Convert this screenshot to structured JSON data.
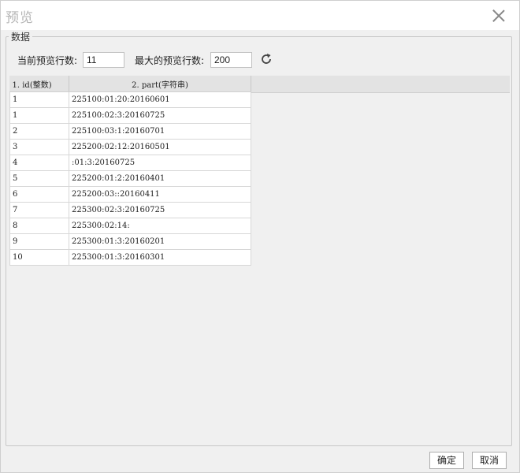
{
  "dialog": {
    "title": "预览",
    "group_title": "数据"
  },
  "controls": {
    "current_rows_label": "当前预览行数:",
    "current_rows_value": "11",
    "max_rows_label": "最大的预览行数:",
    "max_rows_value": "200",
    "refresh_icon": "refresh-icon"
  },
  "table": {
    "headers": [
      "1. id(整数)",
      "2. part(字符串)"
    ],
    "rows": [
      [
        "1",
        "225100:01:20:20160601"
      ],
      [
        "1",
        "225100:02:3:20160725"
      ],
      [
        "2",
        "225100:03:1:20160701"
      ],
      [
        "3",
        "225200:02:12:20160501"
      ],
      [
        "4",
        ":01:3:20160725"
      ],
      [
        "5",
        "225200:01:2:20160401"
      ],
      [
        "6",
        "225200:03::20160411"
      ],
      [
        "7",
        "225300:02:3:20160725"
      ],
      [
        "8",
        "225300:02:14:"
      ],
      [
        "9",
        "225300:01:3:20160201"
      ],
      [
        "10",
        "225300:01:3:20160301"
      ]
    ]
  },
  "buttons": {
    "ok": "确定",
    "cancel": "取消"
  }
}
